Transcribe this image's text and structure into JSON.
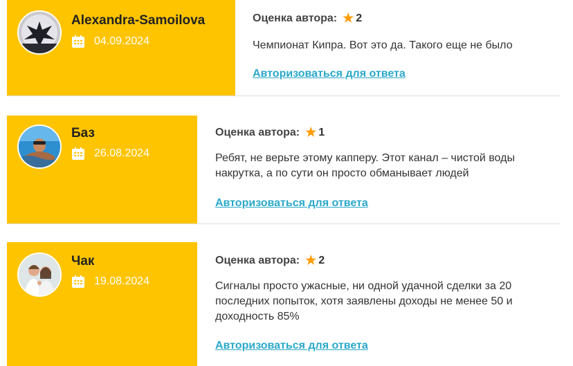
{
  "reviews": [
    {
      "name": "Alexandra-Samoilova",
      "date": "04.09.2024",
      "rating_label": "Оценка автора:",
      "rating": "2",
      "text": "Чемпионат Кипра. Вот это да. Такого еще не было",
      "reply_link": "Авторизоваться для ответа",
      "avatar_icon": "dragon-avatar"
    },
    {
      "name": "Баз",
      "date": "26.08.2024",
      "rating_label": "Оценка автора:",
      "rating": "1",
      "text": "Ребят, не верьте этому капперу. Этот канал – чистой воды накрутка, а по сути он просто обманывает людей",
      "reply_link": "Авторизоваться для ответа",
      "avatar_icon": "swimmer-avatar"
    },
    {
      "name": "Чак",
      "date": "19.08.2024",
      "rating_label": "Оценка автора:",
      "rating": "2",
      "text": "Сигналы просто ужасные, ни одной удачной сделки за 20 последних попыток, хотя заявлены доходы не менее 50 и доходность 85%",
      "reply_link": "Авторизоваться для ответа",
      "avatar_icon": "couple-avatar"
    }
  ],
  "colors": {
    "card": "#ffc400",
    "link": "#2aa8c9",
    "star": "#ff9d00"
  }
}
